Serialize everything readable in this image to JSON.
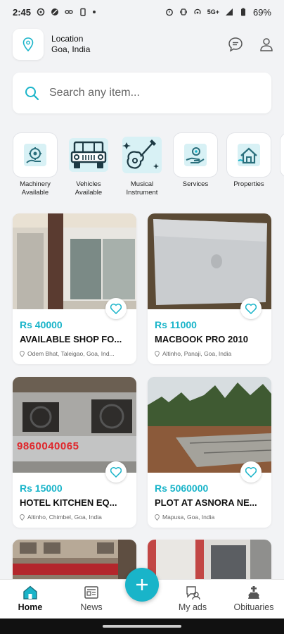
{
  "status_bar": {
    "time": "2:45",
    "battery": "69%",
    "network": "5G+"
  },
  "header": {
    "location_label": "Location",
    "location_value": "Goa, India"
  },
  "search": {
    "placeholder": "Search any item..."
  },
  "categories": [
    {
      "label": "Machinery Available",
      "icon": "machinery-icon"
    },
    {
      "label": "Vehicles Available",
      "icon": "jeep-icon"
    },
    {
      "label": "Musical Instrument",
      "icon": "guitar-icon"
    },
    {
      "label": "Services",
      "icon": "services-icon"
    },
    {
      "label": "Properties",
      "icon": "house-icon"
    }
  ],
  "listings": [
    {
      "price": "Rs 40000",
      "title": "AVAILABLE SHOP FO...",
      "place": "Odem Bhat, Taleigao, Goa, Ind..."
    },
    {
      "price": "Rs 11000",
      "title": "MACBOOK PRO 2010",
      "place": "Altinho, Panaji, Goa, India"
    },
    {
      "price": "Rs 15000",
      "title": "HOTEL KITCHEN EQ...",
      "place": "Altinho, Chimbel, Goa, India",
      "image_text": "9860040065"
    },
    {
      "price": "Rs 5060000",
      "title": "PLOT AT ASNORA NE...",
      "place": "Mapusa, Goa, India"
    }
  ],
  "bottom_nav": {
    "home": "Home",
    "news": "News",
    "my_ads": "My ads",
    "obituaries": "Obituaries"
  },
  "colors": {
    "accent": "#19b4c9",
    "background": "#f2f3f5"
  }
}
